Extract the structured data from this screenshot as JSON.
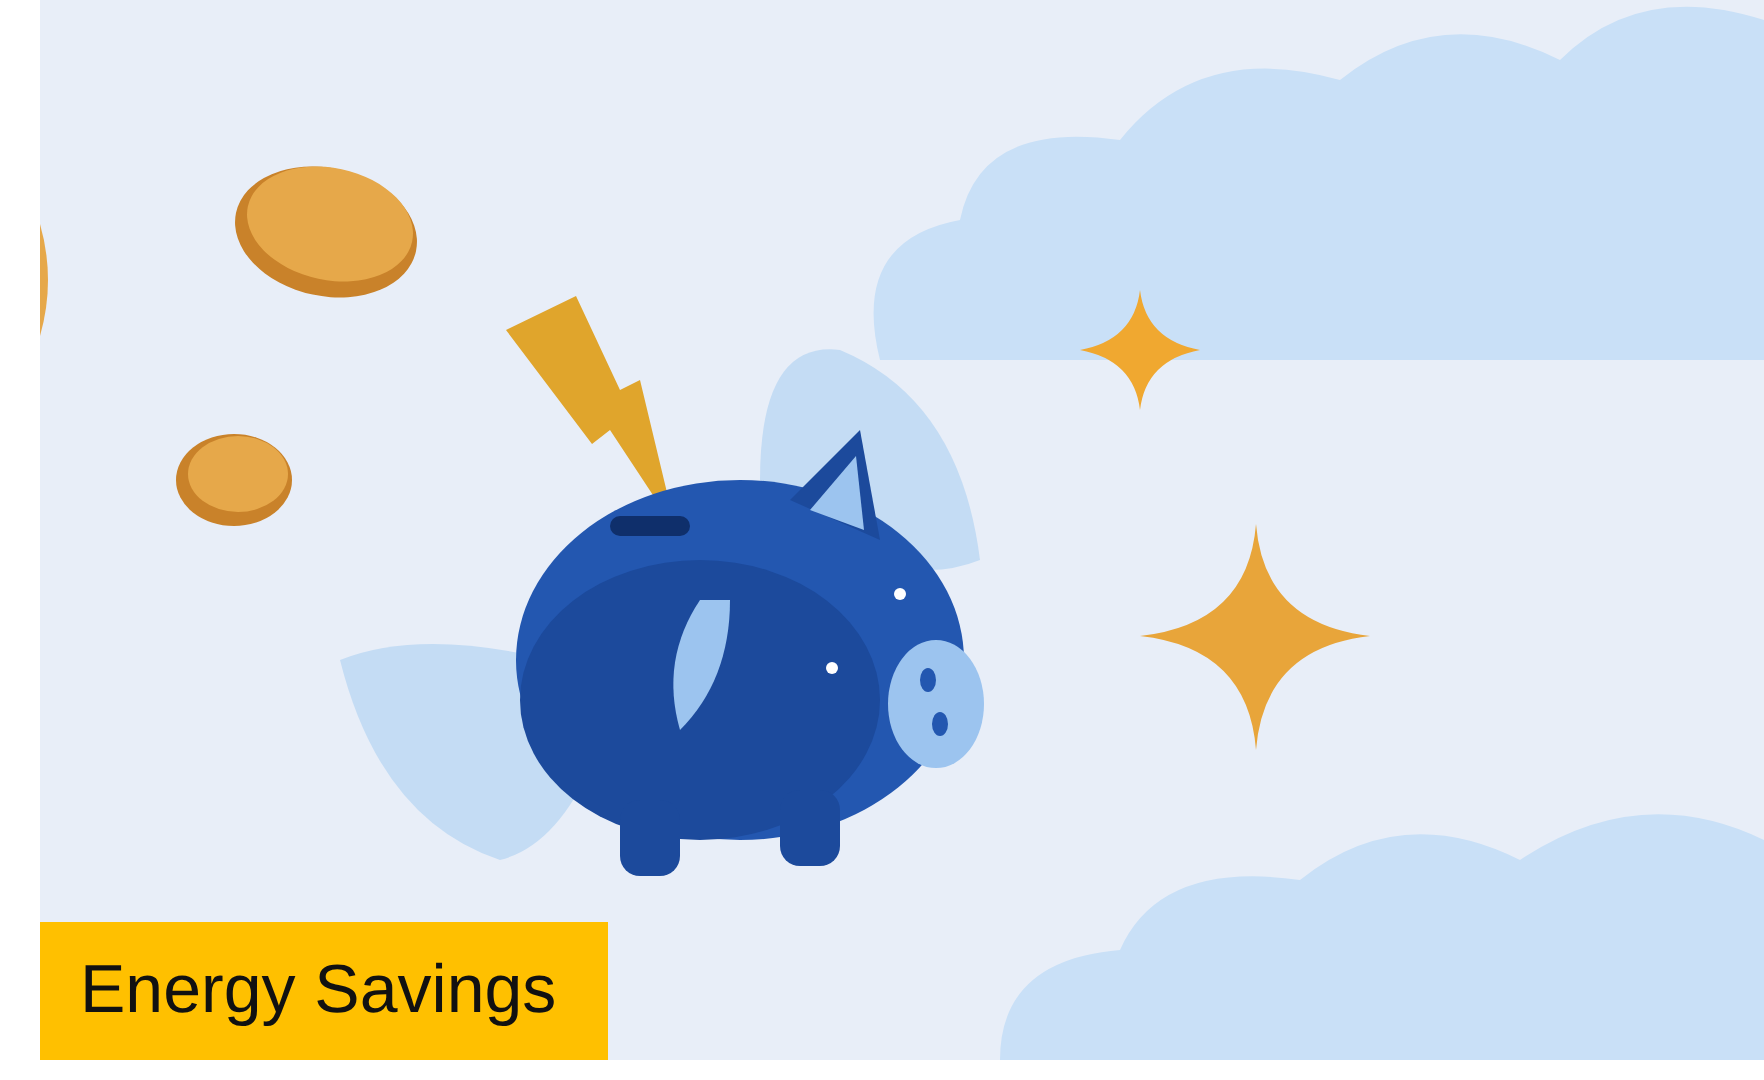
{
  "tile": {
    "caption": "Energy Savings"
  }
}
